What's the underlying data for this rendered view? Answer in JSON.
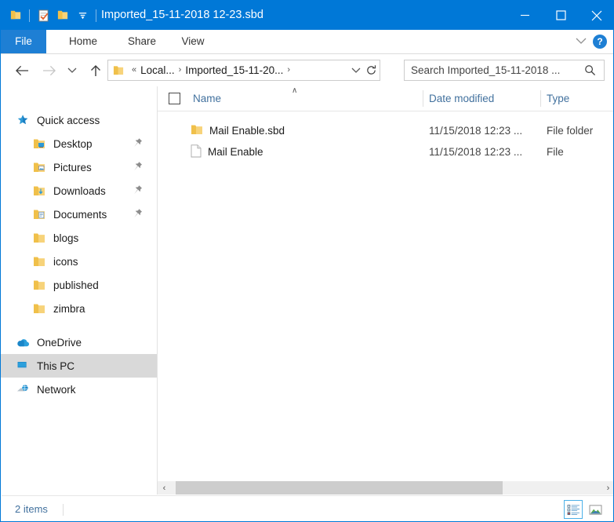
{
  "window": {
    "title": "Imported_15-11-2018 12-23.sbd",
    "accent_color": "#0078D7",
    "quick_access_toolbar": [
      {
        "name": "folder-icon",
        "label": "Folder"
      },
      {
        "name": "properties-icon",
        "label": "Properties"
      },
      {
        "name": "new-folder-icon",
        "label": "New folder"
      },
      {
        "name": "customize-qat-icon",
        "label": "Customize Quick Access Toolbar"
      }
    ],
    "buttons": {
      "minimize": "Minimize",
      "maximize": "Maximize",
      "close": "Close"
    }
  },
  "ribbon": {
    "tabs": [
      {
        "label": "File",
        "active": true
      },
      {
        "label": "Home",
        "active": false
      },
      {
        "label": "Share",
        "active": false
      },
      {
        "label": "View",
        "active": false
      }
    ],
    "expand_label": "Expand the Ribbon",
    "help_label": "?"
  },
  "addressbar": {
    "back_label": "Back",
    "forward_label": "Forward",
    "recent_label": "Recent locations",
    "up_label": "Up",
    "breadcrumb": {
      "overflow": "«",
      "items": [
        "Local...",
        "Imported_15-11-20..."
      ],
      "separator": "›"
    },
    "dropdown_label": "Previous locations",
    "refresh_label": "Refresh",
    "search": {
      "value": "Search Imported_15-11-2018 ...",
      "placeholder": "Search Imported_15-11-2018 ..."
    }
  },
  "sidebar": {
    "items": [
      {
        "label": "Quick access",
        "icon": "star-icon",
        "level": 0,
        "pinned": false,
        "selected": false
      },
      {
        "label": "Desktop",
        "icon": "desktop-folder-icon",
        "level": 1,
        "pinned": true,
        "selected": false
      },
      {
        "label": "Pictures",
        "icon": "pictures-folder-icon",
        "level": 1,
        "pinned": true,
        "selected": false
      },
      {
        "label": "Downloads",
        "icon": "downloads-folder-icon",
        "level": 1,
        "pinned": true,
        "selected": false
      },
      {
        "label": "Documents",
        "icon": "documents-folder-icon",
        "level": 1,
        "pinned": true,
        "selected": false
      },
      {
        "label": "blogs",
        "icon": "folder-icon",
        "level": 1,
        "pinned": false,
        "selected": false
      },
      {
        "label": "icons",
        "icon": "folder-icon",
        "level": 1,
        "pinned": false,
        "selected": false
      },
      {
        "label": "published",
        "icon": "folder-icon",
        "level": 1,
        "pinned": false,
        "selected": false
      },
      {
        "label": "zimbra",
        "icon": "folder-icon",
        "level": 1,
        "pinned": false,
        "selected": false
      },
      {
        "label": "OneDrive",
        "icon": "cloud-icon",
        "level": 0,
        "pinned": false,
        "selected": false
      },
      {
        "label": "This PC",
        "icon": "this-pc-icon",
        "level": 0,
        "pinned": false,
        "selected": true
      },
      {
        "label": "Network",
        "icon": "network-icon",
        "level": 0,
        "pinned": false,
        "selected": false
      }
    ]
  },
  "filelist": {
    "select_all_label": "Select all",
    "sort_indicator": "∧",
    "columns": [
      {
        "label": "Name"
      },
      {
        "label": "Date modified"
      },
      {
        "label": "Type"
      }
    ],
    "rows": [
      {
        "name": "Mail Enable.sbd",
        "date_modified": "11/15/2018 12:23 ...",
        "type": "File folder",
        "icon": "folder-icon"
      },
      {
        "name": "Mail Enable",
        "date_modified": "11/15/2018 12:23 ...",
        "type": "File",
        "icon": "file-icon"
      }
    ]
  },
  "scrollbar": {
    "left_arrow": "‹",
    "right_arrow": "›"
  },
  "statusbar": {
    "item_count": "2 items",
    "view_details_label": "Details view",
    "view_thumbnails_label": "Large icons view"
  }
}
